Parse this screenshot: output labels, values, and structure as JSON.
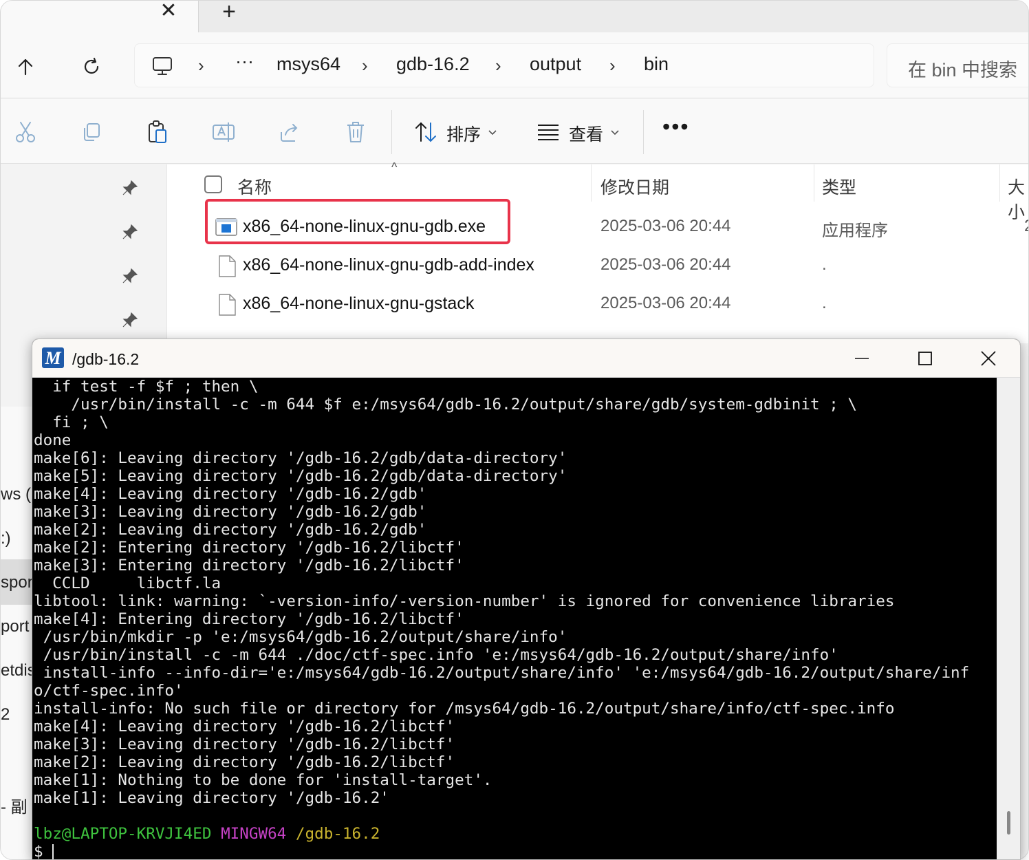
{
  "explorer": {
    "tab": {
      "close_glyph": "✕",
      "new_glyph": "+"
    },
    "breadcrumb": {
      "ellipsis": "···",
      "items": [
        "msys64",
        "gdb-16.2",
        "output",
        "bin"
      ],
      "separator": "›"
    },
    "search": {
      "placeholder": "在 bin 中搜索"
    },
    "toolbar": {
      "sort_label": "排序",
      "view_label": "查看",
      "more_label": "•••"
    },
    "columns": {
      "name": "名称",
      "modified": "修改日期",
      "type": "类型",
      "size": "大小"
    },
    "files": [
      {
        "name": "x86_64-none-linux-gnu-gdb.exe",
        "modified": "2025-03-06 20:44",
        "type": "应用程序",
        "size": "2",
        "icon": "exe-icon"
      },
      {
        "name": "x86_64-none-linux-gnu-gdb-add-index",
        "modified": "2025-03-06 20:44",
        "type": ".",
        "size": "",
        "icon": "file-icon"
      },
      {
        "name": "x86_64-none-linux-gnu-gstack",
        "modified": "2025-03-06 20:44",
        "type": ".",
        "size": "",
        "icon": "file-icon"
      }
    ],
    "left_fragments": [
      "ws (C",
      ":)",
      "spor",
      "port",
      "etdis",
      "2",
      "- 副"
    ],
    "highlight_color": "#e8334a"
  },
  "terminal": {
    "title": "/gdb-16.2",
    "lines": [
      "  if test -f $f ; then \\",
      "    /usr/bin/install -c -m 644 $f e:/msys64/gdb-16.2/output/share/gdb/system-gdbinit ; \\",
      "  fi ; \\",
      "done",
      "make[6]: Leaving directory '/gdb-16.2/gdb/data-directory'",
      "make[5]: Leaving directory '/gdb-16.2/gdb/data-directory'",
      "make[4]: Leaving directory '/gdb-16.2/gdb'",
      "make[3]: Leaving directory '/gdb-16.2/gdb'",
      "make[2]: Leaving directory '/gdb-16.2/gdb'",
      "make[2]: Entering directory '/gdb-16.2/libctf'",
      "make[3]: Entering directory '/gdb-16.2/libctf'",
      "  CCLD     libctf.la",
      "libtool: link: warning: `-version-info/-version-number' is ignored for convenience libraries",
      "make[4]: Entering directory '/gdb-16.2/libctf'",
      " /usr/bin/mkdir -p 'e:/msys64/gdb-16.2/output/share/info'",
      " /usr/bin/install -c -m 644 ./doc/ctf-spec.info 'e:/msys64/gdb-16.2/output/share/info'",
      " install-info --info-dir='e:/msys64/gdb-16.2/output/share/info' 'e:/msys64/gdb-16.2/output/share/inf",
      "o/ctf-spec.info'",
      "install-info: No such file or directory for /msys64/gdb-16.2/output/share/info/ctf-spec.info",
      "make[4]: Leaving directory '/gdb-16.2/libctf'",
      "make[3]: Leaving directory '/gdb-16.2/libctf'",
      "make[2]: Leaving directory '/gdb-16.2/libctf'",
      "make[1]: Nothing to be done for 'install-target'.",
      "make[1]: Leaving directory '/gdb-16.2'",
      ""
    ],
    "prompt": {
      "user": "lbz@LAPTOP-KRVJI4ED",
      "system": "MINGW64",
      "path": "/gdb-16.2",
      "symbol": "$"
    },
    "colors": {
      "user": "#3ec23e",
      "system": "#c542c5",
      "path": "#c9b32e"
    }
  }
}
